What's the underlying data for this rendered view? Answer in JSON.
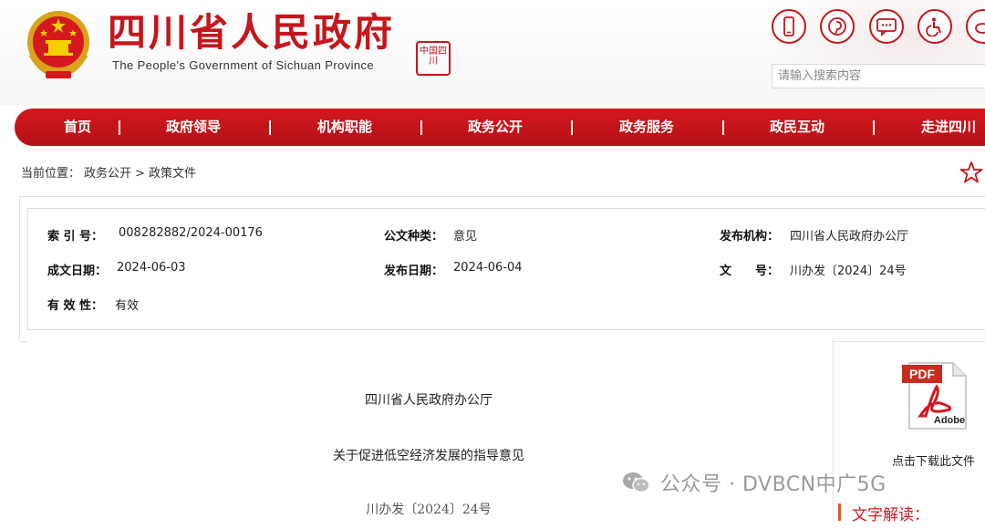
{
  "header": {
    "title": "四川省人民政府",
    "subtitle": "The People's Government of Sichuan Province",
    "seal_text": "中国四川"
  },
  "tools": [
    {
      "name": "mobile-icon"
    },
    {
      "name": "pinterest-icon"
    },
    {
      "name": "message-icon"
    },
    {
      "name": "accessibility-icon"
    },
    {
      "name": "weibo-icon"
    }
  ],
  "search": {
    "placeholder": "请输入搜索内容"
  },
  "nav": {
    "items": [
      "首页",
      "政府领导",
      "机构职能",
      "政务公开",
      "政务服务",
      "政民互动",
      "走进四川"
    ]
  },
  "breadcrumb": {
    "label": "当前位置：",
    "path": [
      "政务公开",
      "政策文件"
    ],
    "separator": ">"
  },
  "info": {
    "index_label": "索 引 号：",
    "index_value": "008282882/2024-00176",
    "type_label": "公文种类：",
    "type_value": "意见",
    "org_label": "发布机构：",
    "org_value": "四川省人民政府办公厅",
    "date_label": "成文日期：",
    "date_value": "2024-06-03",
    "pub_label": "发布日期：",
    "pub_value": "2024-06-04",
    "doc_no_label": "文　　号：",
    "doc_no_value": "川办发〔2024〕24号",
    "validity_label": "有 效 性：",
    "validity_value": "有效"
  },
  "document": {
    "issuer": "四川省人民政府办公厅",
    "title": "关于促进低空经济发展的指导意见",
    "number": "川办发〔2024〕24号"
  },
  "sidebar": {
    "pdf_tag": "PDF",
    "pdf_brand": "Adobe",
    "download_label": "点击下载此文件",
    "interpretation_label": "文字解读："
  },
  "watermark": {
    "text": "公众号 · DVBCN中广5G"
  },
  "colors": {
    "brand_red": "#c4161c",
    "nav_red": "#d5181f",
    "accent_orange": "#e0561c"
  }
}
